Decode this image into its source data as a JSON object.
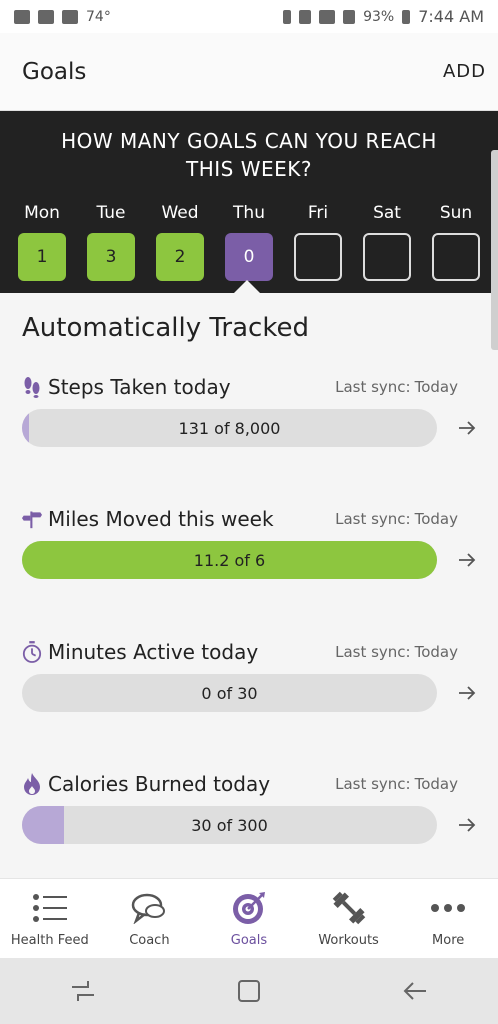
{
  "status_bar": {
    "temp": "74°",
    "battery": "93%",
    "time": "7:44 AM"
  },
  "app_bar": {
    "title": "Goals",
    "add_label": "ADD"
  },
  "week": {
    "question": "HOW MANY GOALS CAN YOU REACH THIS WEEK?",
    "days": [
      {
        "name": "Mon",
        "value": "1",
        "state": "done"
      },
      {
        "name": "Tue",
        "value": "3",
        "state": "done"
      },
      {
        "name": "Wed",
        "value": "2",
        "state": "done"
      },
      {
        "name": "Thu",
        "value": "0",
        "state": "today"
      },
      {
        "name": "Fri",
        "value": "",
        "state": "empty"
      },
      {
        "name": "Sat",
        "value": "",
        "state": "empty"
      },
      {
        "name": "Sun",
        "value": "",
        "state": "empty"
      }
    ]
  },
  "tracked": {
    "title": "Automatically Tracked",
    "goals": [
      {
        "label": "Steps Taken today",
        "icon": "footsteps-icon",
        "sync_label": "Last sync:",
        "sync_value": "Today",
        "progress_text": "131 of 8,000",
        "progress": 0.016,
        "fill_color": "#b7a8d6"
      },
      {
        "label": "Miles Moved this week",
        "icon": "signpost-icon",
        "sync_label": "Last sync:",
        "sync_value": "Today",
        "progress_text": "11.2 of 6",
        "progress": 1.0,
        "fill_color": "#8dc63f"
      },
      {
        "label": "Minutes Active today",
        "icon": "stopwatch-icon",
        "sync_label": "Last sync:",
        "sync_value": "Today",
        "progress_text": "0 of 30",
        "progress": 0.0,
        "fill_color": "#b7a8d6"
      },
      {
        "label": "Calories Burned today",
        "icon": "flame-icon",
        "sync_label": "Last sync:",
        "sync_value": "Today",
        "progress_text": "30 of 300",
        "progress": 0.1,
        "fill_color": "#b7a8d6"
      }
    ]
  },
  "bottom_nav": {
    "items": [
      {
        "label": "Health Feed",
        "icon": "list-icon"
      },
      {
        "label": "Coach",
        "icon": "chat-bubbles-icon"
      },
      {
        "label": "Goals",
        "icon": "target-icon",
        "active": true
      },
      {
        "label": "Workouts",
        "icon": "dumbbell-icon"
      },
      {
        "label": "More",
        "icon": "more-dots-icon"
      }
    ]
  },
  "colors": {
    "accent": "#7b5ea7",
    "done": "#8dc63f",
    "banner": "#222222"
  }
}
